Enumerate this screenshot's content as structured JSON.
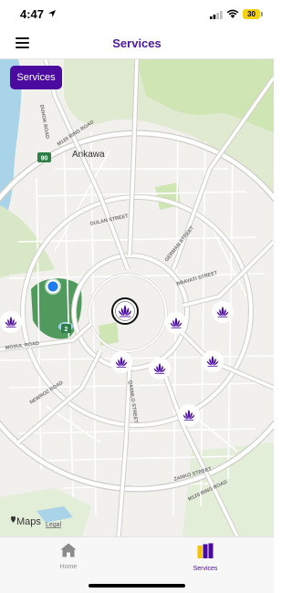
{
  "status_bar": {
    "time": "4:47",
    "battery": "30"
  },
  "header": {
    "title": "Services",
    "menu_icon": "hamburger-menu-icon"
  },
  "map": {
    "filter_chip": "Services",
    "labels": {
      "ankawa": "Ankawa",
      "ring_road_m120": "M120 RING ROAD",
      "ring_road_m120_south": "M120 RING ROAD",
      "gulan_street": "GULAN STREET",
      "german_street": "GERMAN STREET",
      "brayati_street": "BRAYATI STREET",
      "mosul_road": "MOSUL ROAD",
      "newroz_road": "NEWROZ ROAD",
      "qasmlo_street": "QASMLO STREET",
      "zanko_street": "ZANKO STREET",
      "duhok_road": "DUHOK ROAD",
      "route_90": "90",
      "route_2": "2",
      "maps_brand": "Maps",
      "legal": "Legal"
    },
    "marker_icon": "lotus-icon",
    "user_location_icon": "user-location-dot-icon",
    "colors": {
      "accent": "#4b0ba0",
      "park": "#cfe6b4",
      "park_dark": "#4f9a5c",
      "water": "#a9d3e8",
      "road": "#ffffff",
      "road_casing": "#d0cec8",
      "ring": "#c9c7c1"
    }
  },
  "tabs": [
    {
      "label": "Home",
      "icon": "home-icon",
      "active": false
    },
    {
      "label": "Services",
      "icon": "services-grid-icon",
      "active": true
    }
  ]
}
